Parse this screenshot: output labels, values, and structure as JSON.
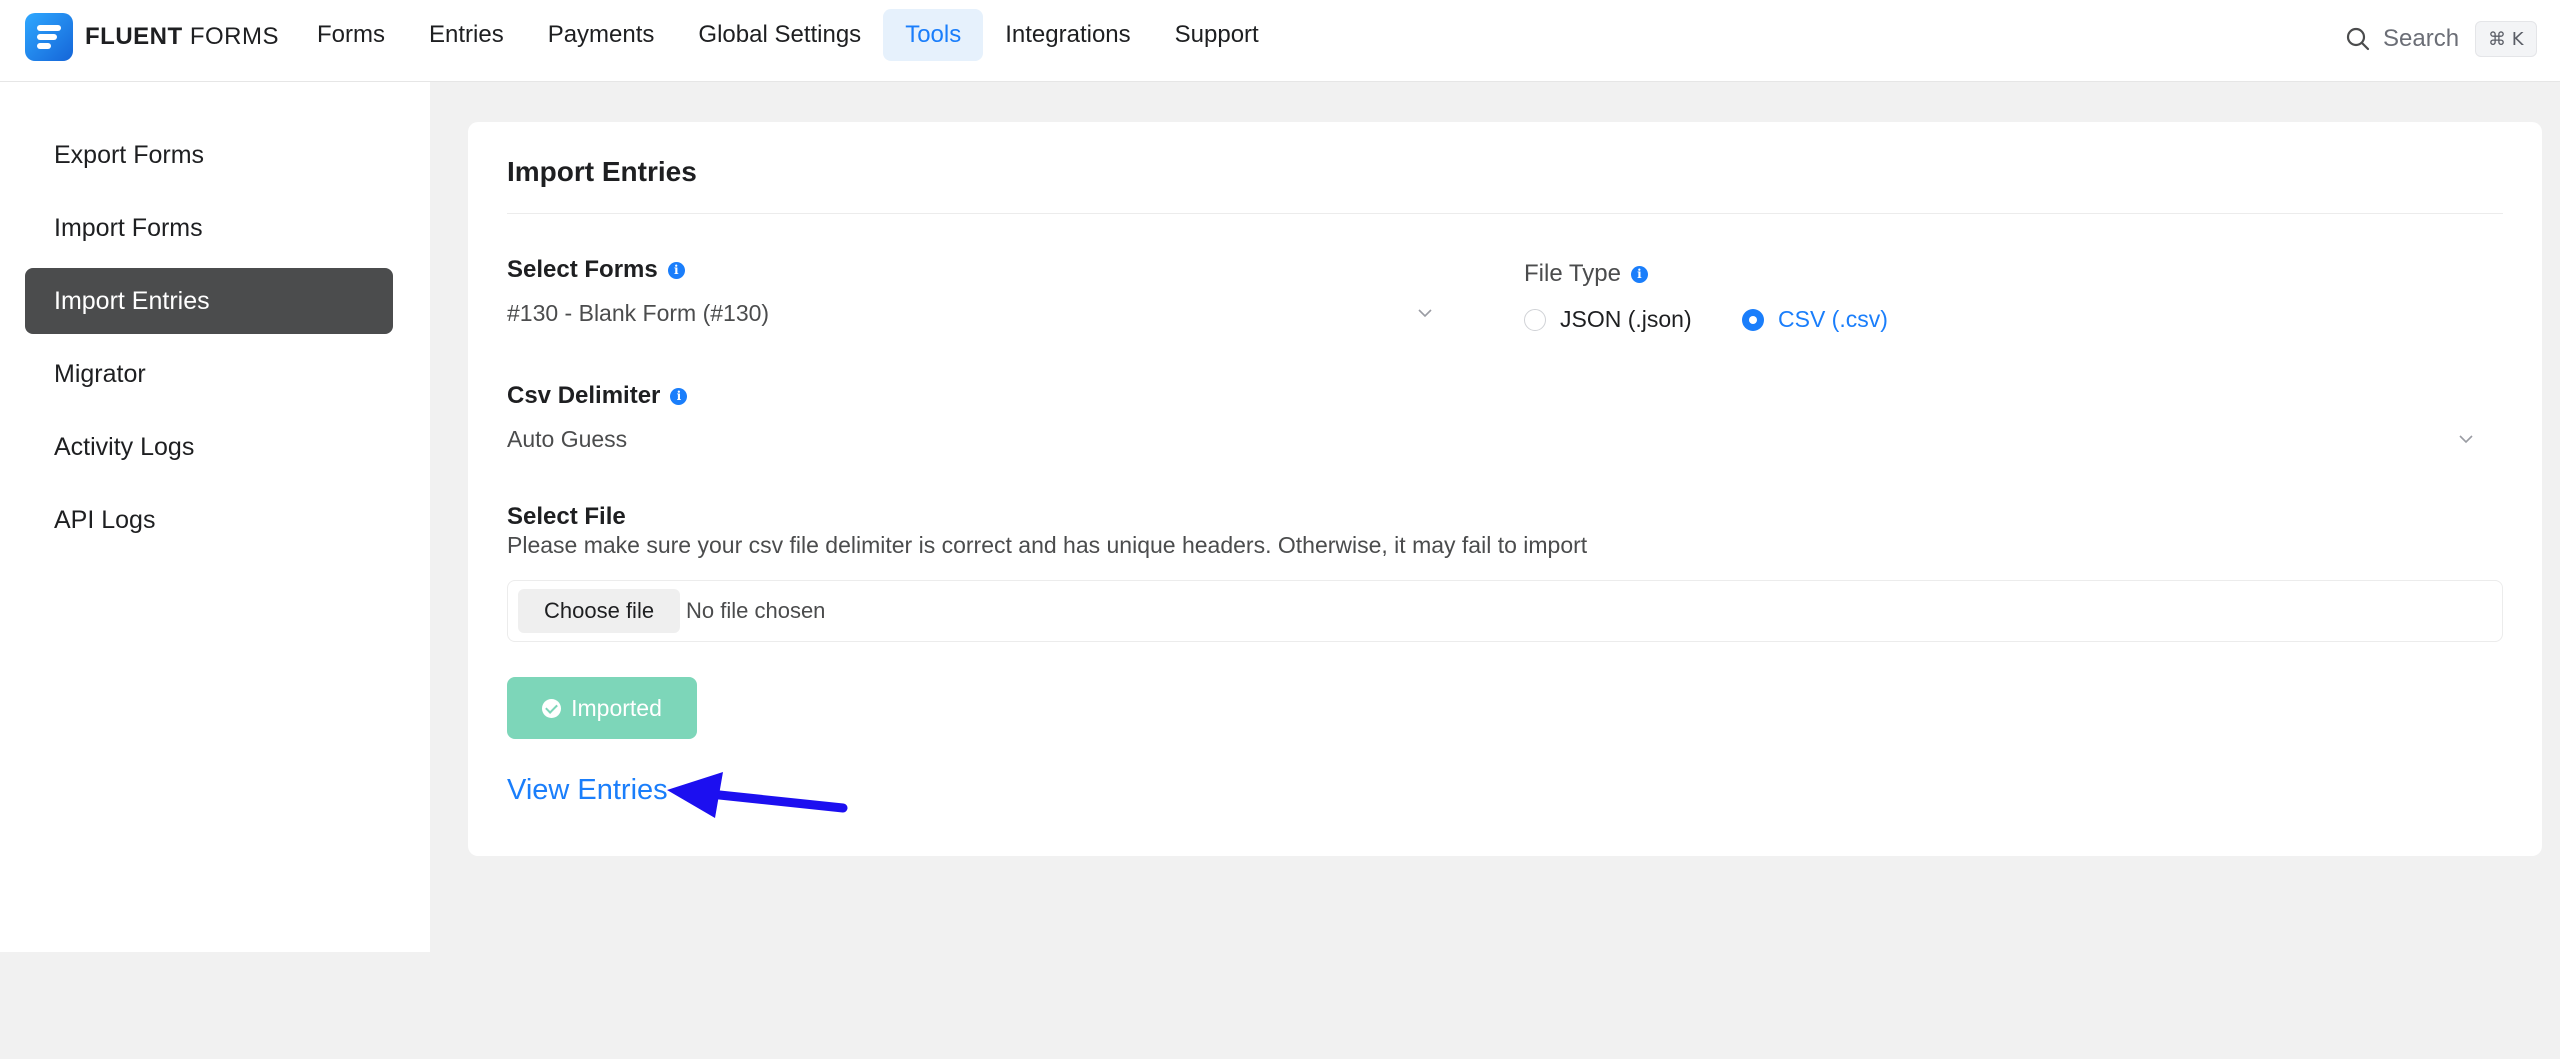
{
  "brand": {
    "name_bold": "FLUENT",
    "name_light": "FORMS"
  },
  "nav": {
    "items": [
      {
        "label": "Forms",
        "active": false
      },
      {
        "label": "Entries",
        "active": false
      },
      {
        "label": "Payments",
        "active": false
      },
      {
        "label": "Global Settings",
        "active": false
      },
      {
        "label": "Tools",
        "active": true
      },
      {
        "label": "Integrations",
        "active": false
      },
      {
        "label": "Support",
        "active": false
      }
    ],
    "search_label": "Search",
    "search_shortcut": "⌘ K"
  },
  "sidebar": {
    "items": [
      {
        "label": "Export Forms",
        "active": false
      },
      {
        "label": "Import Forms",
        "active": false
      },
      {
        "label": "Import Entries",
        "active": true
      },
      {
        "label": "Migrator",
        "active": false
      },
      {
        "label": "Activity Logs",
        "active": false
      },
      {
        "label": "API Logs",
        "active": false
      }
    ]
  },
  "main": {
    "title": "Import Entries",
    "select_forms": {
      "label": "Select Forms",
      "value": "#130 - Blank Form (#130)"
    },
    "file_type": {
      "label": "File Type",
      "options": [
        {
          "label": "JSON (.json)",
          "checked": false
        },
        {
          "label": "CSV (.csv)",
          "checked": true
        }
      ]
    },
    "csv_delimiter": {
      "label": "Csv Delimiter",
      "value": "Auto Guess"
    },
    "select_file": {
      "label": "Select File",
      "help": "Please make sure your csv file delimiter is correct and has unique headers. Otherwise, it may fail to import",
      "choose_label": "Choose file",
      "status": "No file chosen"
    },
    "imported_label": "Imported",
    "view_entries_label": "View Entries"
  },
  "colors": {
    "accent": "#1a7efb",
    "sidebar_active": "#4b4c4d",
    "imported_button": "#7dd6b9",
    "annotation_arrow": "#1c0ff0"
  }
}
